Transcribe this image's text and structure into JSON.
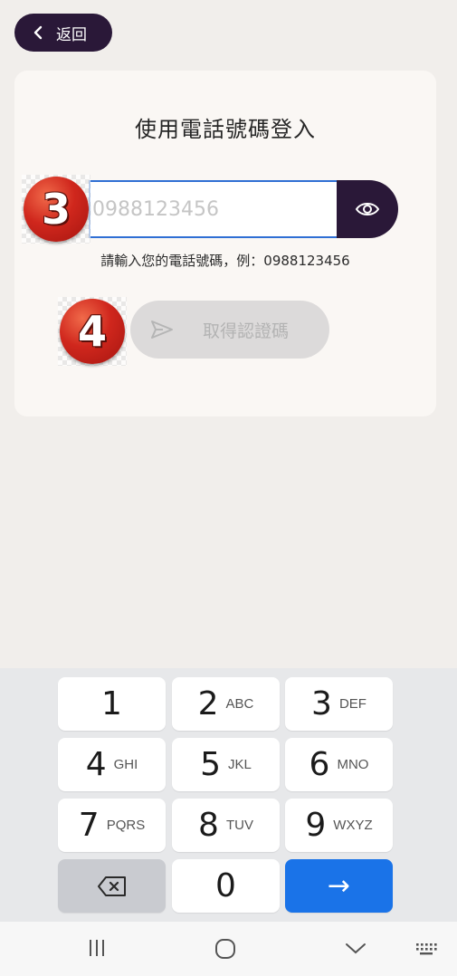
{
  "header": {
    "back_label": "返回"
  },
  "login": {
    "title": "使用電話號碼登入",
    "phone_placeholder": "0988123456",
    "phone_value": "",
    "hint": "請輸入您的電話號碼，例：0988123456",
    "get_code_label": "取得認證碼"
  },
  "step_markers": [
    "3",
    "4"
  ],
  "keyboard": {
    "keys": [
      {
        "num": "1",
        "letters": ""
      },
      {
        "num": "2",
        "letters": "ABC"
      },
      {
        "num": "3",
        "letters": "DEF"
      },
      {
        "num": "4",
        "letters": "GHI"
      },
      {
        "num": "5",
        "letters": "JKL"
      },
      {
        "num": "6",
        "letters": "MNO"
      },
      {
        "num": "7",
        "letters": "PQRS"
      },
      {
        "num": "8",
        "letters": "TUV"
      },
      {
        "num": "9",
        "letters": "WXYZ"
      },
      {
        "num": "0",
        "letters": ""
      }
    ],
    "enter_symbol": "→"
  },
  "icons": {
    "back": "chevron-left-icon",
    "eye": "eye-icon",
    "send": "send-icon",
    "backspace": "backspace-icon",
    "nav_recent": "recent-apps-icon",
    "nav_home": "home-icon",
    "nav_back": "chevron-down-icon",
    "nav_keyboard": "keyboard-icon"
  },
  "colors": {
    "accent": "#2a1838",
    "input_border": "#2f6fd4",
    "enter_key": "#1a73e8"
  }
}
